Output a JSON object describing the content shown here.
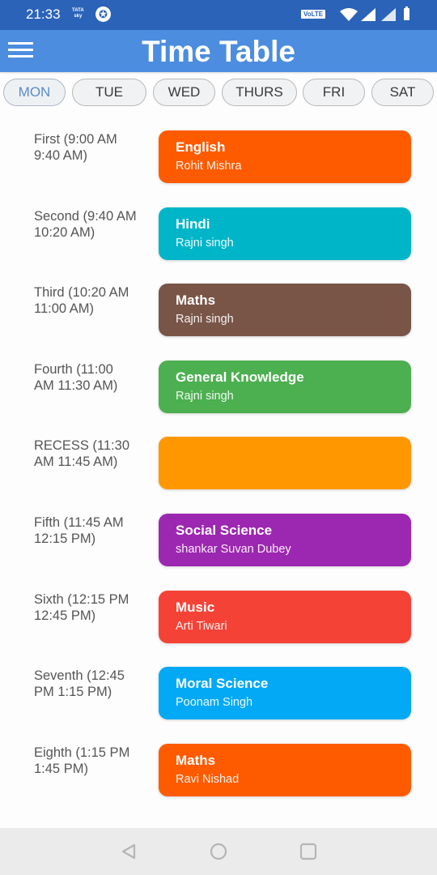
{
  "status_bar": {
    "time": "21:33",
    "carrier_logo": "TATA sky",
    "volte_label": "VoLTE",
    "icons": [
      "tata-sky-icon",
      "star-badge-icon",
      "volte-icon",
      "wifi-icon",
      "signal-icon",
      "signal-icon",
      "battery-icon"
    ]
  },
  "app_bar": {
    "title": "Time Table",
    "menu_icon": "hamburger-menu-icon"
  },
  "tabs": [
    {
      "label": "MON",
      "active": true
    },
    {
      "label": "TUE",
      "active": false
    },
    {
      "label": "WED",
      "active": false
    },
    {
      "label": "THURS",
      "active": false
    },
    {
      "label": "FRI",
      "active": false
    },
    {
      "label": "SAT",
      "active": false
    }
  ],
  "schedule": [
    {
      "period": "First (9:00 AM\n9:40 AM)",
      "subject": "English",
      "teacher": "Rohit Mishra",
      "color": "#fe5b00"
    },
    {
      "period": "Second (9:40 AM\n10:20 AM)",
      "subject": "Hindi",
      "teacher": "Rajni singh",
      "color": "#00b5c8"
    },
    {
      "period": "Third (10:20 AM\n11:00 AM)",
      "subject": "Maths",
      "teacher": "Rajni singh",
      "color": "#795548"
    },
    {
      "period": "Fourth (11:00\nAM  11:30 AM)",
      "subject": "General Knowledge",
      "teacher": "Rajni singh",
      "color": "#4caf50"
    },
    {
      "period": "RECESS (11:30\nAM  11:45 AM)",
      "subject": "",
      "teacher": "",
      "color": "#ff9800"
    },
    {
      "period": "Fifth (11:45 AM\n12:15 PM)",
      "subject": "Social Science",
      "teacher": "shankar Suvan Dubey",
      "color": "#9c27b0"
    },
    {
      "period": "Sixth (12:15 PM\n12:45 PM)",
      "subject": "Music",
      "teacher": "Arti Tiwari",
      "color": "#f44336"
    },
    {
      "period": "Seventh (12:45\nPM  1:15 PM)",
      "subject": "Moral Science",
      "teacher": "Poonam Singh",
      "color": "#03a9f4"
    },
    {
      "period": "Eighth (1:15 PM\n1:45 PM)",
      "subject": "Maths",
      "teacher": "Ravi Nishad",
      "color": "#fe5b00"
    }
  ],
  "nav_bar": {
    "icons": [
      "back-icon",
      "home-icon",
      "recents-icon"
    ]
  },
  "colors": {
    "status_bar": "#2a63b8",
    "app_bar": "#4c8ddf",
    "active_tab_text": "#5a8cc4"
  }
}
